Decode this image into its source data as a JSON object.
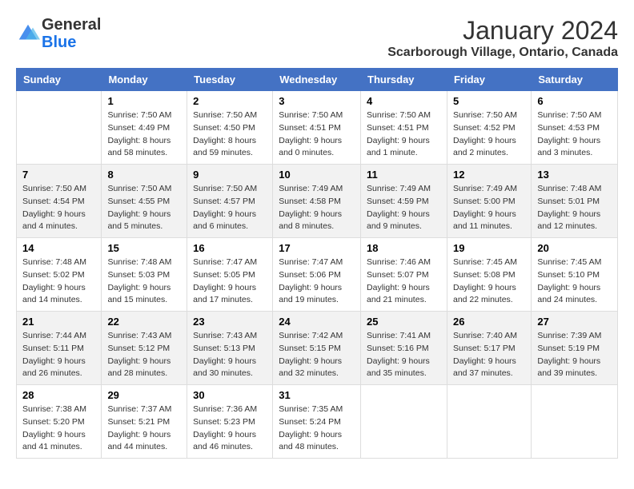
{
  "logo": {
    "text_general": "General",
    "text_blue": "Blue"
  },
  "title": "January 2024",
  "subtitle": "Scarborough Village, Ontario, Canada",
  "headers": [
    "Sunday",
    "Monday",
    "Tuesday",
    "Wednesday",
    "Thursday",
    "Friday",
    "Saturday"
  ],
  "weeks": [
    [
      {
        "day": "",
        "sunrise": "",
        "sunset": "",
        "daylight": ""
      },
      {
        "day": "1",
        "sunrise": "Sunrise: 7:50 AM",
        "sunset": "Sunset: 4:49 PM",
        "daylight": "Daylight: 8 hours and 58 minutes."
      },
      {
        "day": "2",
        "sunrise": "Sunrise: 7:50 AM",
        "sunset": "Sunset: 4:50 PM",
        "daylight": "Daylight: 8 hours and 59 minutes."
      },
      {
        "day": "3",
        "sunrise": "Sunrise: 7:50 AM",
        "sunset": "Sunset: 4:51 PM",
        "daylight": "Daylight: 9 hours and 0 minutes."
      },
      {
        "day": "4",
        "sunrise": "Sunrise: 7:50 AM",
        "sunset": "Sunset: 4:51 PM",
        "daylight": "Daylight: 9 hours and 1 minute."
      },
      {
        "day": "5",
        "sunrise": "Sunrise: 7:50 AM",
        "sunset": "Sunset: 4:52 PM",
        "daylight": "Daylight: 9 hours and 2 minutes."
      },
      {
        "day": "6",
        "sunrise": "Sunrise: 7:50 AM",
        "sunset": "Sunset: 4:53 PM",
        "daylight": "Daylight: 9 hours and 3 minutes."
      }
    ],
    [
      {
        "day": "7",
        "sunrise": "Sunrise: 7:50 AM",
        "sunset": "Sunset: 4:54 PM",
        "daylight": "Daylight: 9 hours and 4 minutes."
      },
      {
        "day": "8",
        "sunrise": "Sunrise: 7:50 AM",
        "sunset": "Sunset: 4:55 PM",
        "daylight": "Daylight: 9 hours and 5 minutes."
      },
      {
        "day": "9",
        "sunrise": "Sunrise: 7:50 AM",
        "sunset": "Sunset: 4:57 PM",
        "daylight": "Daylight: 9 hours and 6 minutes."
      },
      {
        "day": "10",
        "sunrise": "Sunrise: 7:49 AM",
        "sunset": "Sunset: 4:58 PM",
        "daylight": "Daylight: 9 hours and 8 minutes."
      },
      {
        "day": "11",
        "sunrise": "Sunrise: 7:49 AM",
        "sunset": "Sunset: 4:59 PM",
        "daylight": "Daylight: 9 hours and 9 minutes."
      },
      {
        "day": "12",
        "sunrise": "Sunrise: 7:49 AM",
        "sunset": "Sunset: 5:00 PM",
        "daylight": "Daylight: 9 hours and 11 minutes."
      },
      {
        "day": "13",
        "sunrise": "Sunrise: 7:48 AM",
        "sunset": "Sunset: 5:01 PM",
        "daylight": "Daylight: 9 hours and 12 minutes."
      }
    ],
    [
      {
        "day": "14",
        "sunrise": "Sunrise: 7:48 AM",
        "sunset": "Sunset: 5:02 PM",
        "daylight": "Daylight: 9 hours and 14 minutes."
      },
      {
        "day": "15",
        "sunrise": "Sunrise: 7:48 AM",
        "sunset": "Sunset: 5:03 PM",
        "daylight": "Daylight: 9 hours and 15 minutes."
      },
      {
        "day": "16",
        "sunrise": "Sunrise: 7:47 AM",
        "sunset": "Sunset: 5:05 PM",
        "daylight": "Daylight: 9 hours and 17 minutes."
      },
      {
        "day": "17",
        "sunrise": "Sunrise: 7:47 AM",
        "sunset": "Sunset: 5:06 PM",
        "daylight": "Daylight: 9 hours and 19 minutes."
      },
      {
        "day": "18",
        "sunrise": "Sunrise: 7:46 AM",
        "sunset": "Sunset: 5:07 PM",
        "daylight": "Daylight: 9 hours and 21 minutes."
      },
      {
        "day": "19",
        "sunrise": "Sunrise: 7:45 AM",
        "sunset": "Sunset: 5:08 PM",
        "daylight": "Daylight: 9 hours and 22 minutes."
      },
      {
        "day": "20",
        "sunrise": "Sunrise: 7:45 AM",
        "sunset": "Sunset: 5:10 PM",
        "daylight": "Daylight: 9 hours and 24 minutes."
      }
    ],
    [
      {
        "day": "21",
        "sunrise": "Sunrise: 7:44 AM",
        "sunset": "Sunset: 5:11 PM",
        "daylight": "Daylight: 9 hours and 26 minutes."
      },
      {
        "day": "22",
        "sunrise": "Sunrise: 7:43 AM",
        "sunset": "Sunset: 5:12 PM",
        "daylight": "Daylight: 9 hours and 28 minutes."
      },
      {
        "day": "23",
        "sunrise": "Sunrise: 7:43 AM",
        "sunset": "Sunset: 5:13 PM",
        "daylight": "Daylight: 9 hours and 30 minutes."
      },
      {
        "day": "24",
        "sunrise": "Sunrise: 7:42 AM",
        "sunset": "Sunset: 5:15 PM",
        "daylight": "Daylight: 9 hours and 32 minutes."
      },
      {
        "day": "25",
        "sunrise": "Sunrise: 7:41 AM",
        "sunset": "Sunset: 5:16 PM",
        "daylight": "Daylight: 9 hours and 35 minutes."
      },
      {
        "day": "26",
        "sunrise": "Sunrise: 7:40 AM",
        "sunset": "Sunset: 5:17 PM",
        "daylight": "Daylight: 9 hours and 37 minutes."
      },
      {
        "day": "27",
        "sunrise": "Sunrise: 7:39 AM",
        "sunset": "Sunset: 5:19 PM",
        "daylight": "Daylight: 9 hours and 39 minutes."
      }
    ],
    [
      {
        "day": "28",
        "sunrise": "Sunrise: 7:38 AM",
        "sunset": "Sunset: 5:20 PM",
        "daylight": "Daylight: 9 hours and 41 minutes."
      },
      {
        "day": "29",
        "sunrise": "Sunrise: 7:37 AM",
        "sunset": "Sunset: 5:21 PM",
        "daylight": "Daylight: 9 hours and 44 minutes."
      },
      {
        "day": "30",
        "sunrise": "Sunrise: 7:36 AM",
        "sunset": "Sunset: 5:23 PM",
        "daylight": "Daylight: 9 hours and 46 minutes."
      },
      {
        "day": "31",
        "sunrise": "Sunrise: 7:35 AM",
        "sunset": "Sunset: 5:24 PM",
        "daylight": "Daylight: 9 hours and 48 minutes."
      },
      {
        "day": "",
        "sunrise": "",
        "sunset": "",
        "daylight": ""
      },
      {
        "day": "",
        "sunrise": "",
        "sunset": "",
        "daylight": ""
      },
      {
        "day": "",
        "sunrise": "",
        "sunset": "",
        "daylight": ""
      }
    ]
  ]
}
